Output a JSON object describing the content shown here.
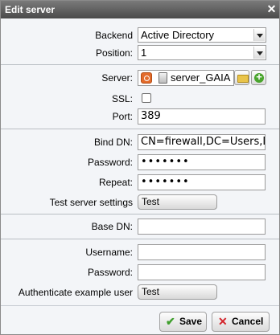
{
  "window": {
    "title": "Edit server",
    "close_glyph": "✕"
  },
  "fields": {
    "backend": {
      "label": "Backend",
      "value": "Active Directory"
    },
    "position": {
      "label": "Position:",
      "value": "1"
    },
    "server": {
      "label": "Server:",
      "value": "server_GAIA",
      "icons": [
        "object-icon",
        "server-icon",
        "folder-icon",
        "add-icon"
      ]
    },
    "ssl": {
      "label": "SSL:",
      "checked": false
    },
    "port": {
      "label": "Port:",
      "value": "389"
    },
    "bind_dn": {
      "label": "Bind DN:",
      "value": "CN=firewall,DC=Users,DC"
    },
    "password": {
      "label": "Password:",
      "value": "•••••••"
    },
    "repeat": {
      "label": "Repeat:",
      "value": "•••••••"
    },
    "test_server": {
      "label": "Test server settings",
      "button": "Test"
    },
    "base_dn": {
      "label": "Base DN:",
      "value": ""
    },
    "username": {
      "label": "Username:",
      "value": ""
    },
    "password2": {
      "label": "Password:",
      "value": ""
    },
    "auth_example": {
      "label": "Authenticate example user",
      "button": "Test"
    }
  },
  "buttons": {
    "save": "Save",
    "cancel": "Cancel"
  },
  "colors": {
    "titlebar": "#5a5a5a",
    "save_icon": "#3f9f2d",
    "cancel_icon": "#d3232a",
    "object_icon": "#e36b2a",
    "add_icon": "#4aa52e"
  }
}
